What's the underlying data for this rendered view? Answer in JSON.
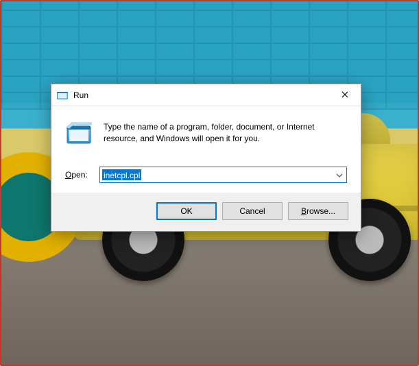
{
  "dialog": {
    "title": "Run",
    "description": "Type the name of a program, folder, document, or Internet resource, and Windows will open it for you.",
    "open_label": "Open:",
    "open_value": "inetcpl.cpl",
    "buttons": {
      "ok": "OK",
      "cancel": "Cancel",
      "browse_prefix": "B",
      "browse_rest": "rowse..."
    }
  },
  "icons": {
    "app": "run-program-icon",
    "close": "close-icon",
    "dropdown": "chevron-down-icon"
  },
  "colors": {
    "accent": "#0078d7",
    "window_bg": "#ffffff",
    "footer_bg": "#f0f0f0"
  }
}
